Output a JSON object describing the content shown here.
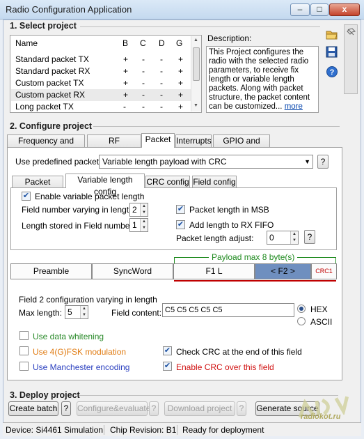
{
  "window": {
    "title": "Radio Configuration Application",
    "min_glyph": "–",
    "max_glyph": "□",
    "close_glyph": "x"
  },
  "section1": {
    "title": "1. Select project",
    "columns": [
      "Name",
      "B",
      "C",
      "D",
      "G"
    ],
    "rows": [
      {
        "name": "Standard packet TX",
        "b": "+",
        "c": "-",
        "d": "-",
        "g": "+"
      },
      {
        "name": "Standard packet RX",
        "b": "+",
        "c": "-",
        "d": "-",
        "g": "+"
      },
      {
        "name": "Custom packet TX",
        "b": "+",
        "c": "-",
        "d": "-",
        "g": "+"
      },
      {
        "name": "Custom packet RX",
        "b": "+",
        "c": "-",
        "d": "-",
        "g": "+"
      },
      {
        "name": "Long packet TX",
        "b": "-",
        "c": "-",
        "d": "-",
        "g": "+"
      }
    ],
    "selected_row": 3,
    "description_label": "Description:",
    "description_text": "This Project configures the radio with the selected radio parameters, to receive fix length or variable length packets. Along with packet structure, the packet content can be customized...",
    "description_link": "more"
  },
  "section2": {
    "title": "2. Configure project",
    "tabs": [
      "Frequency and power",
      "RF parameters",
      "Packet",
      "Interrupts",
      "GPIO and FRR"
    ],
    "active_tab": "Packet",
    "predefined_label": "Use predefined packet:",
    "predefined_value": "Variable length payload with CRC",
    "help": "?",
    "subtabs": [
      "Packet config",
      "Variable length config",
      "CRC config",
      "Field config"
    ],
    "active_subtab": "Variable length config",
    "enable_variable_label": "Enable variable packet length",
    "field_number_label": "Field number varying in length:",
    "field_number_value": "2",
    "stored_in_label": "Length stored in Field number:",
    "stored_in_value": "1",
    "msb_label": "Packet length in MSB",
    "add_rx_fifo_label": "Add length to RX FIFO",
    "adjust_label": "Packet length adjust:",
    "adjust_value": "0",
    "payload_label": "Payload max 8 byte(s)",
    "packet_fields": [
      "Preamble",
      "SyncWord",
      "F1 L",
      "< F2 >",
      "CRC1"
    ],
    "field2_title": "Field 2 configuration varying in length",
    "max_length_label": "Max length:",
    "max_length_value": "5",
    "field_content_label": "Field content:",
    "field_content_value": "C5  C5  C5  C5  C5",
    "hex_label": "HEX",
    "ascii_label": "ASCII",
    "whitening_label": "Use data whitening",
    "fsk_label": "Use 4(G)FSK modulation",
    "manchester_label": "Use Manchester encoding",
    "check_crc_label": "Check CRC at the end of this field",
    "enable_crc_label": "Enable CRC over this field",
    "colors": {
      "whitening": "#2a8a2a",
      "fsk": "#e07a10",
      "manchester": "#2a3fbf",
      "enable_crc": "#d01010",
      "payload": "#1e8a1e",
      "crc_red": "#c00000",
      "f2_fill": "#6f8fbf"
    }
  },
  "section3": {
    "title": "3. Deploy project",
    "create_batch": "Create batch",
    "configure_evaluate": "Configure&evaluate",
    "download_project": "Download project",
    "generate_source": "Generate source",
    "help": "?"
  },
  "status": {
    "device": "Device: Si4461  Simulation",
    "chip_revision": "Chip Revision: B1",
    "state": "Ready for deployment"
  },
  "watermark": {
    "text": "radiokot.ru"
  }
}
